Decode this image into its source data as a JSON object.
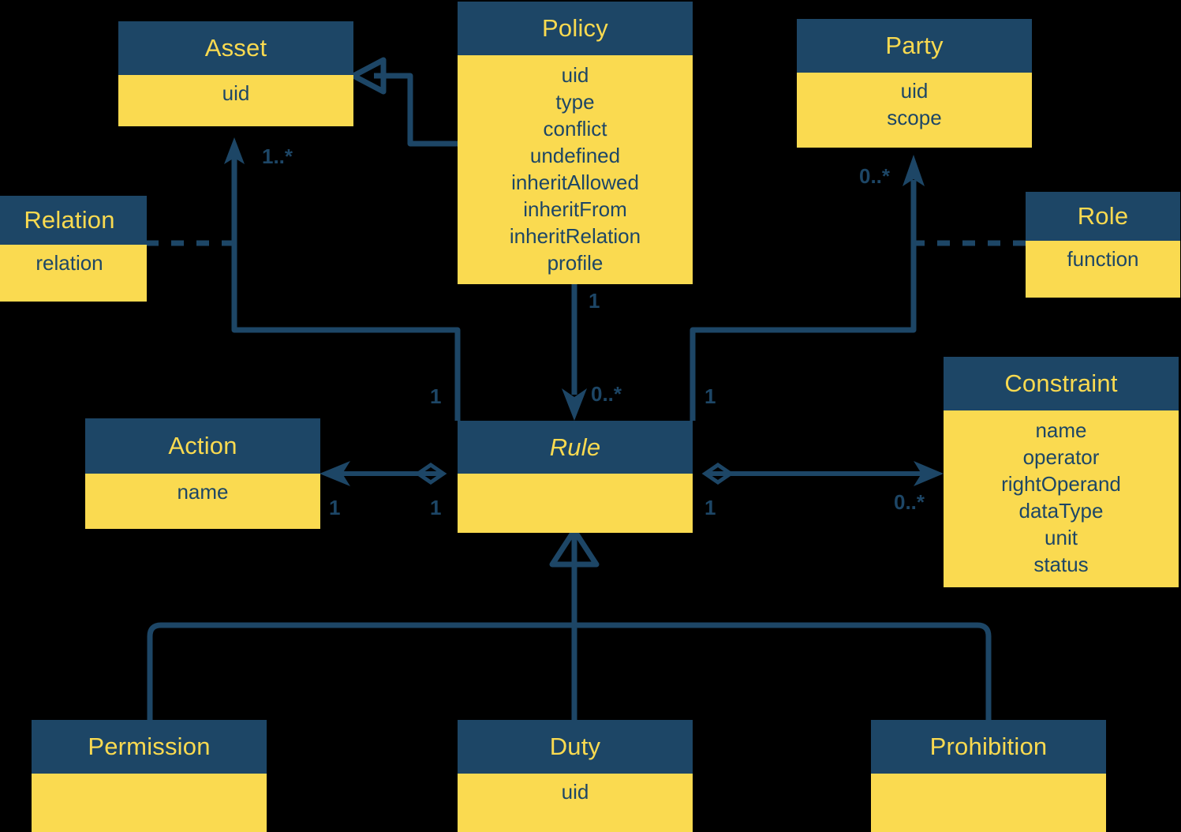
{
  "diagram": {
    "type": "uml-class-diagram",
    "colors": {
      "background": "#000000",
      "header_fill": "#1d4666",
      "header_text": "#fada50",
      "body_fill": "#fada50",
      "body_text": "#1d4666",
      "edge": "#1d4666"
    },
    "classes": [
      {
        "id": "asset",
        "name": "Asset",
        "abstract": false,
        "attributes": [
          "uid"
        ]
      },
      {
        "id": "policy",
        "name": "Policy",
        "abstract": false,
        "attributes": [
          "uid",
          "type",
          "conflict",
          "undefined",
          "inheritAllowed",
          "inheritFrom",
          "inheritRelation",
          "profile"
        ]
      },
      {
        "id": "party",
        "name": "Party",
        "abstract": false,
        "attributes": [
          "uid",
          "scope"
        ]
      },
      {
        "id": "relation",
        "name": "Relation",
        "abstract": false,
        "attributes": [
          "relation"
        ]
      },
      {
        "id": "role",
        "name": "Role",
        "abstract": false,
        "attributes": [
          "function"
        ]
      },
      {
        "id": "action",
        "name": "Action",
        "abstract": false,
        "attributes": [
          "name"
        ]
      },
      {
        "id": "rule",
        "name": "Rule",
        "abstract": true,
        "attributes": []
      },
      {
        "id": "constraint",
        "name": "Constraint",
        "abstract": false,
        "attributes": [
          "name",
          "operator",
          "rightOperand",
          "dataType",
          "unit",
          "status"
        ]
      },
      {
        "id": "permission",
        "name": "Permission",
        "abstract": false,
        "attributes": []
      },
      {
        "id": "duty",
        "name": "Duty",
        "abstract": false,
        "attributes": [
          "uid"
        ]
      },
      {
        "id": "prohibition",
        "name": "Prohibition",
        "abstract": false,
        "attributes": []
      }
    ],
    "multiplicities": {
      "asset_from_rule": "1..*",
      "policy_to_rule_source": "1",
      "policy_to_rule_target": "0..*",
      "rule_to_asset_source": "1",
      "rule_to_party_source": "1",
      "party_from_rule": "0..*",
      "rule_to_action_target": "1",
      "rule_to_action_source": "1",
      "rule_to_constraint_source": "1",
      "rule_to_constraint_target": "0..*"
    },
    "relationships": [
      {
        "from": "policy",
        "to": "asset",
        "kind": "generalization"
      },
      {
        "from": "policy",
        "to": "rule",
        "kind": "association",
        "source_mult": "1",
        "target_mult": "0..*"
      },
      {
        "from": "rule",
        "to": "asset",
        "kind": "association",
        "source_mult": "1",
        "target_mult": "1..*"
      },
      {
        "from": "rule",
        "to": "party",
        "kind": "association",
        "source_mult": "1",
        "target_mult": "0..*"
      },
      {
        "from": "rule",
        "to": "action",
        "kind": "aggregation",
        "source_mult": "1",
        "target_mult": "1"
      },
      {
        "from": "rule",
        "to": "constraint",
        "kind": "aggregation",
        "source_mult": "1",
        "target_mult": "0..*"
      },
      {
        "from": "relation",
        "to": "rule_asset_link",
        "kind": "dependency"
      },
      {
        "from": "role",
        "to": "rule_party_link",
        "kind": "dependency"
      },
      {
        "from": "permission",
        "to": "rule",
        "kind": "generalization"
      },
      {
        "from": "duty",
        "to": "rule",
        "kind": "generalization"
      },
      {
        "from": "prohibition",
        "to": "rule",
        "kind": "generalization"
      }
    ]
  }
}
